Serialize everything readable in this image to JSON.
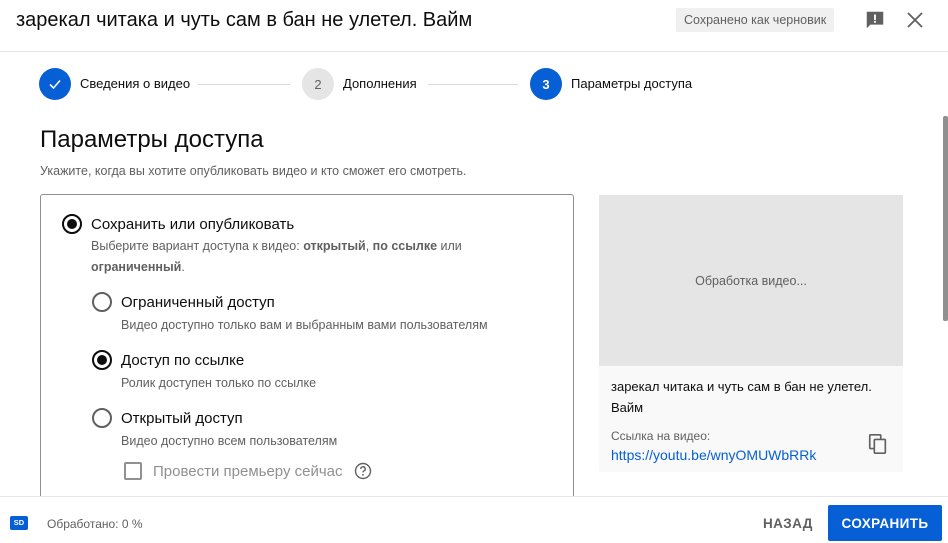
{
  "header": {
    "title": "зарекал читака и чуть сам в бан не улетел. Вайм",
    "draft_status": "Сохранено как черновик",
    "icons": {
      "feedback": "feedback-icon",
      "close": "close-icon"
    }
  },
  "stepper": {
    "steps": [
      {
        "number": "",
        "label": "Сведения о видео",
        "state": "done",
        "icon": "check-icon"
      },
      {
        "number": "2",
        "label": "Дополнения",
        "state": "inactive"
      },
      {
        "number": "3",
        "label": "Параметры доступа",
        "state": "active"
      }
    ]
  },
  "main": {
    "title": "Параметры доступа",
    "subtitle": "Укажите, когда вы хотите опубликовать видео и кто сможет его смотреть."
  },
  "visibility": {
    "save_publish": {
      "label": "Сохранить или опубликовать",
      "desc_prefix": "Выберите вариант доступа к видео: ",
      "desc_public": "открытый",
      "desc_sep": ", ",
      "desc_unlisted": "по ссылке",
      "desc_or": " или",
      "desc_private": "ограниченный",
      "desc_end": ".",
      "checked": true
    },
    "options": [
      {
        "label": "Ограниченный доступ",
        "desc": "Видео доступно только вам и выбранным вами пользователям",
        "checked": false
      },
      {
        "label": "Доступ по ссылке",
        "desc": "Ролик доступен только по ссылке",
        "checked": true
      },
      {
        "label": "Открытый доступ",
        "desc": "Видео доступно всем пользователям",
        "checked": false
      }
    ],
    "premiere": {
      "label": "Провести премьеру сейчас",
      "checked": false
    }
  },
  "preview": {
    "processing": "Обработка видео...",
    "video_title": "зарекал читака и чуть сам в бан не улетел. Вайм",
    "link_caption": "Ссылка на видео:",
    "link": "https://youtu.be/wnyOMUWbRRk"
  },
  "footer": {
    "quality_badge": "SD",
    "processed": "Обработано: 0 %",
    "back_label": "НАЗАД",
    "save_label": "СОХРАНИТЬ"
  },
  "colors": {
    "accent": "#065fd4",
    "text_secondary": "#606060",
    "thumb_bg": "#e5e5e5"
  }
}
